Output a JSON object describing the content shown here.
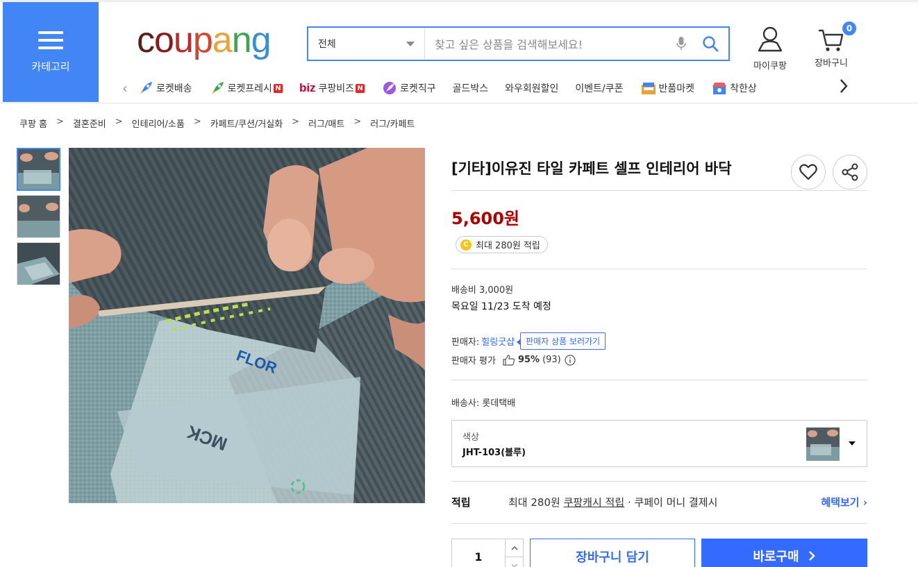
{
  "header": {
    "category_label": "카테고리",
    "logo": [
      "c",
      "o",
      "u",
      "p",
      "a",
      "n",
      "g"
    ],
    "logo_colors": [
      "#5a1f16",
      "#8a1a1a",
      "#c2292b",
      "#d6432f",
      "#e8a33a",
      "#3ba650",
      "#3b8fce"
    ],
    "search_scope": "전체",
    "search_placeholder": "찾고 싶은 상품을 검색해보세요!",
    "mycoupang_label": "마이쿠팡",
    "cart_label": "장바구니",
    "cart_count": "0"
  },
  "nav": {
    "items": [
      {
        "label": "로켓배송",
        "icon": "rocket-icon",
        "new": ""
      },
      {
        "label": "로켓프레시",
        "icon": "rocket-fresh-icon",
        "new": "N"
      },
      {
        "label": "쿠팡비즈",
        "prefix": "biz",
        "icon": "",
        "new": "N"
      },
      {
        "label": "로켓직구",
        "icon": "globe-rocket-icon",
        "new": ""
      },
      {
        "label": "골드박스",
        "icon": "",
        "new": ""
      },
      {
        "label": "와우회원할인",
        "icon": "",
        "new": ""
      },
      {
        "label": "이벤트/쿠폰",
        "icon": "",
        "new": ""
      },
      {
        "label": "반품마켓",
        "icon": "sale-box-icon",
        "new": ""
      },
      {
        "label": "착한상",
        "icon": "store-icon",
        "new": ""
      }
    ]
  },
  "breadcrumb": [
    "쿠팡 홈",
    "결혼준비",
    "인테리어/소품",
    "카페트/쿠션/거실화",
    "러그/매트",
    "러그/카페트"
  ],
  "breadcrumb_sep": ">",
  "product": {
    "title": "[기타]이유진 타일 카페트 셀프 인테리어 바닥",
    "price": "5,600원",
    "points_coin": "C",
    "points": "최대 280원 적립",
    "shipping_fee": "배송비 3,000원",
    "arrival": "목요일 11/23 도착 예정",
    "seller_label": "판매자:",
    "seller_name": "힐링굿샵",
    "seller_tooltip": "판매자 상품 보러가기",
    "rating_label": "판매자 평가",
    "rating_pct": "95%",
    "rating_count": "(93)",
    "courier": "배송사: 롯데택배",
    "option_label": "색상",
    "option_value": "JHT-103(블루)",
    "reward_label": "적립",
    "reward_text_pre": "최대 280원 ",
    "reward_link": "쿠팡캐시 적립",
    "reward_text_post": " · 쿠페이 머니 결제시",
    "reward_more": "혜택보기 ›",
    "quantity": "1",
    "add_to_cart": "장바구니 담기",
    "buy_now": "바로구매"
  },
  "colors": {
    "accent": "#4285f4",
    "price": "#ae0000",
    "link": "#346aff"
  }
}
